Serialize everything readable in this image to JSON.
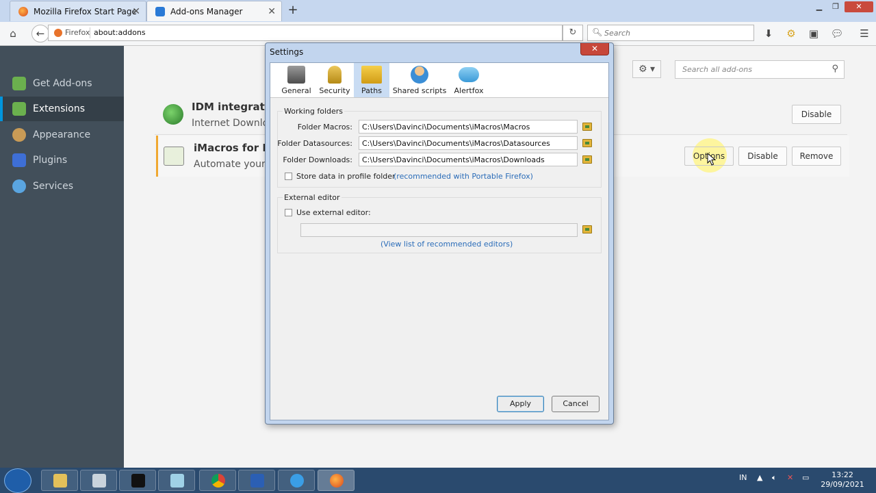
{
  "browser": {
    "tabs": [
      {
        "label": "Mozilla Firefox Start Page",
        "active": false
      },
      {
        "label": "Add-ons Manager",
        "active": true
      }
    ],
    "new_tab_label": "+",
    "identity_label": "Firefox",
    "url": "about:addons",
    "search_placeholder": "Search"
  },
  "sidebar": {
    "items": [
      {
        "label": "Get Add-ons",
        "icon": "get-addons-icon"
      },
      {
        "label": "Extensions",
        "icon": "extensions-icon",
        "selected": true
      },
      {
        "label": "Appearance",
        "icon": "appearance-icon"
      },
      {
        "label": "Plugins",
        "icon": "plugins-icon"
      },
      {
        "label": "Services",
        "icon": "services-icon"
      }
    ]
  },
  "main": {
    "search_placeholder": "Search all add-ons",
    "addons": [
      {
        "name": "IDM integration",
        "desc": "Internet Downloa",
        "buttons": [
          "Disable"
        ]
      },
      {
        "name": "iMacros for Fire",
        "desc": "Automate your w",
        "buttons": [
          "Options",
          "Disable",
          "Remove"
        ]
      }
    ]
  },
  "dialog": {
    "title": "Settings",
    "close": "✕",
    "tabs": [
      {
        "label": "General"
      },
      {
        "label": "Security"
      },
      {
        "label": "Paths",
        "selected": true
      },
      {
        "label": "Shared scripts"
      },
      {
        "label": "Alertfox"
      }
    ],
    "working_folders": {
      "title": "Working folders",
      "rows": [
        {
          "label": "Folder Macros:",
          "value": "C:\\Users\\Davinci\\Documents\\iMacros\\Macros"
        },
        {
          "label": "Folder Datasources:",
          "value": "C:\\Users\\Davinci\\Documents\\iMacros\\Datasources"
        },
        {
          "label": "Folder Downloads:",
          "value": "C:\\Users\\Davinci\\Documents\\iMacros\\Downloads"
        }
      ],
      "store_label": "Store data in profile folder",
      "store_link": "(recommended with Portable Firefox)"
    },
    "external_editor": {
      "title": "External editor",
      "use_label": "Use external editor:",
      "path_value": "",
      "list_link": "(View list of recommended editors)"
    },
    "apply": "Apply",
    "cancel": "Cancel"
  },
  "taskbar": {
    "lang": "IN",
    "time": "13:22",
    "date": "29/09/2021"
  }
}
